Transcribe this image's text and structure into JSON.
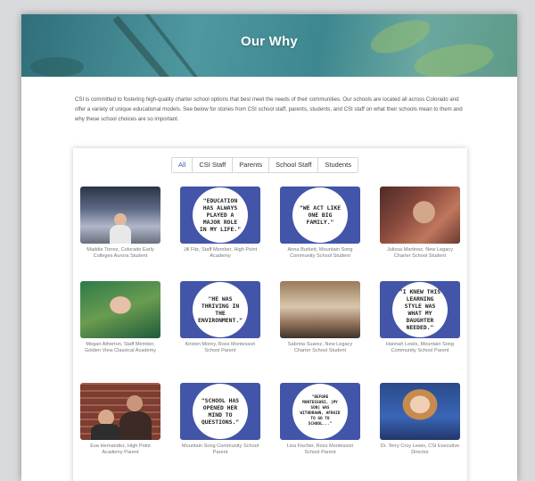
{
  "header": {
    "title": "Our Why"
  },
  "intro": "CSI is committed to fostering high-quality charter school options that best meet the needs of their communities. Our schools are located all across Colorado and offer a variety of unique educational models. See below for stories from CSI school staff, parents, students, and CSI staff on what their schools mean to them and why these school choices are so important.",
  "filters": [
    {
      "label": "All",
      "active": true
    },
    {
      "label": "CSI Staff",
      "active": false
    },
    {
      "label": "Parents",
      "active": false
    },
    {
      "label": "School Staff",
      "active": false
    },
    {
      "label": "Students",
      "active": false
    }
  ],
  "stories": [
    {
      "type": "photo",
      "photo": "classroom",
      "caption": "Maddie Torrez, Colorado Early Colleges Aurora Student"
    },
    {
      "type": "quote",
      "quote": "\"Education has always played a major role in my life.\"",
      "caption": "Jill Fitz, Staff Member, High Point Academy"
    },
    {
      "type": "quote",
      "quote": "\"We act like one big family.\"",
      "caption": "Anna Burkett, Mountain Song Community School Student"
    },
    {
      "type": "photo",
      "photo": "family",
      "caption": "Julissa Martinez, New Legacy Charter School Student"
    },
    {
      "type": "photo",
      "photo": "portrait",
      "caption": "Megan Atherton, Staff Member, Golden View Classical Academy"
    },
    {
      "type": "quote",
      "quote": "\"He was thriving in the environment.\"",
      "caption": "Kirsten Morey, Ross Montessori School Parent"
    },
    {
      "type": "photo",
      "photo": "meeting",
      "caption": "Sabrina Suarez, New Legacy Charter School Student"
    },
    {
      "type": "quote",
      "quote": "\"I knew this learning style was what my daughter needed.\"",
      "caption": "Hannah Lewis, Mountain Song Community School Parent"
    },
    {
      "type": "photo",
      "photo": "brick",
      "caption": "Eva Hernandez, High Point Academy Parent"
    },
    {
      "type": "quote",
      "quote": "\"School has opened her mind to questions.\"",
      "caption": "Mountain Song Community School Parent"
    },
    {
      "type": "quote",
      "small": true,
      "quote": "\"Before Montessori, [my son] was withdrawn, afraid to go to school...\"",
      "caption": "Lisa Fischer, Ross Montessori School Parent"
    },
    {
      "type": "photo",
      "photo": "exec",
      "caption": "Dr. Terry Croy Lewis, CSI Executive Director"
    }
  ],
  "colors": {
    "quote_bg": "#4255a8",
    "active_tab": "#3a57b5",
    "hero": "#3d8790"
  }
}
